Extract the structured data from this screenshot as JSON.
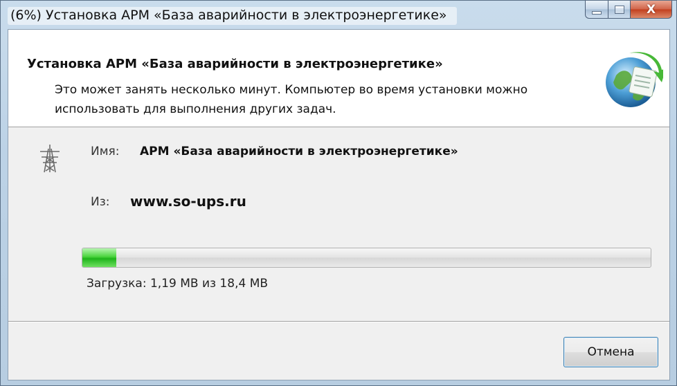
{
  "window": {
    "title": "(6%) Установка АРМ «База аварийности в электроэнергетике»",
    "close_glyph": "X"
  },
  "header": {
    "title": "Установка АРМ «База аварийности в электроэнергетике»",
    "description": "Это может занять несколько минут. Компьютер во время установки можно использовать для выполнения других задач."
  },
  "details": {
    "name_label": "Имя:",
    "name_value": "АРМ «База аварийности в электроэнергетике»",
    "from_label": "Из:",
    "from_value": "www.so-ups.ru"
  },
  "progress": {
    "percent": 6,
    "status_text": "Загрузка: 1,19 МВ из 18,4 МВ"
  },
  "buttons": {
    "cancel_label": "Отмена"
  },
  "icons": {
    "app_icon": "power-tower-icon",
    "header_icon": "globe-install-icon"
  },
  "colors": {
    "progress_green": "#1fb41b",
    "button_border": "#3c7fb1",
    "close_red": "#c2401f"
  }
}
